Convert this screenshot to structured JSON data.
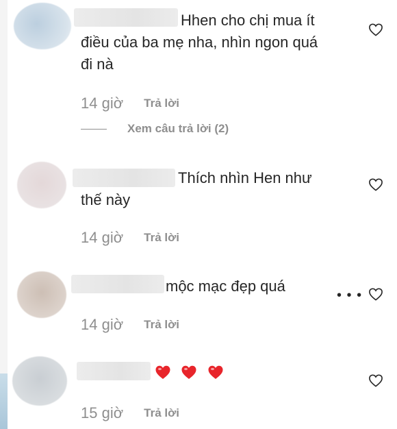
{
  "colors": {
    "text": "#262626",
    "muted": "#8e8e8e",
    "emoji_heart": "#e8252b"
  },
  "comments": [
    {
      "text_lines": [
        "Hhen cho chị mua ít",
        "điều của ba mẹ nha, nhìn ngon quá",
        "đi nà"
      ],
      "time": "14 giờ",
      "reply_label": "Trả lời",
      "view_replies": "Xem câu trả lời (2)"
    },
    {
      "text_lines": [
        "Thích nhìn Hen như",
        "thế này"
      ],
      "time": "14 giờ",
      "reply_label": "Trả lời"
    },
    {
      "text_lines": [
        "mộc mạc đẹp quá"
      ],
      "time": "14 giờ",
      "reply_label": "Trả lời",
      "more_icon": "more-horizontal-icon"
    },
    {
      "emoji": [
        "heart-emoji",
        "heart-emoji",
        "heart-emoji"
      ],
      "time": "15 giờ",
      "reply_label": "Trả lời"
    }
  ],
  "icons": {
    "like": "heart-outline-icon"
  }
}
